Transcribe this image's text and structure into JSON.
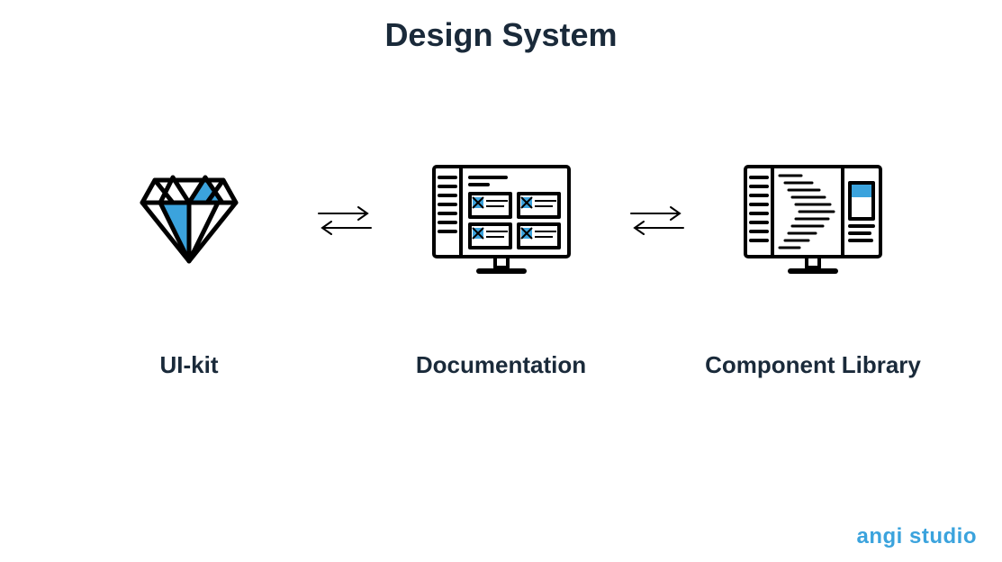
{
  "title": "Design System",
  "items": [
    {
      "label": "UI-kit",
      "icon": "diamond-icon"
    },
    {
      "label": "Documentation",
      "icon": "documentation-monitor-icon"
    },
    {
      "label": "Component Library",
      "icon": "component-library-monitor-icon"
    }
  ],
  "brand": "angi studio",
  "colors": {
    "dark": "#1a2a3a",
    "accent": "#3ba3dd",
    "black": "#000000"
  }
}
